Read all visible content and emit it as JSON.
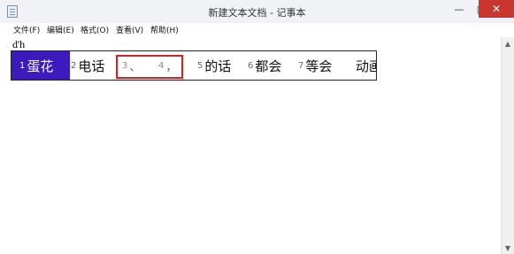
{
  "window": {
    "title": "新建文本文档 - 记事本"
  },
  "controls": {
    "minimize": "—",
    "maximize": "□",
    "close": "✕"
  },
  "menu": [
    "文件(F)",
    "编辑(E)",
    "格式(O)",
    "查看(V)",
    "帮助(H)"
  ],
  "editor": {
    "text": "d'h"
  },
  "ime": {
    "candidates": [
      {
        "num": "1",
        "word": "蛋花"
      },
      {
        "num": "2",
        "word": "电话"
      },
      {
        "num": "3",
        "word": "、"
      },
      {
        "num": "4",
        "word": "，"
      },
      {
        "num": "5",
        "word": "的话"
      },
      {
        "num": "6",
        "word": "都会"
      },
      {
        "num": "7",
        "word": "等会"
      },
      {
        "num": "",
        "word": "动画"
      }
    ],
    "selected_index": 0
  },
  "icons": {
    "app": "notepad-icon",
    "scroll_up": "arrow-up-icon",
    "scroll_down": "arrow-down-icon"
  },
  "colors": {
    "selected_candidate": "#3b1bbd",
    "annotation_box": "#d42222",
    "close_button": "#c7372f"
  }
}
